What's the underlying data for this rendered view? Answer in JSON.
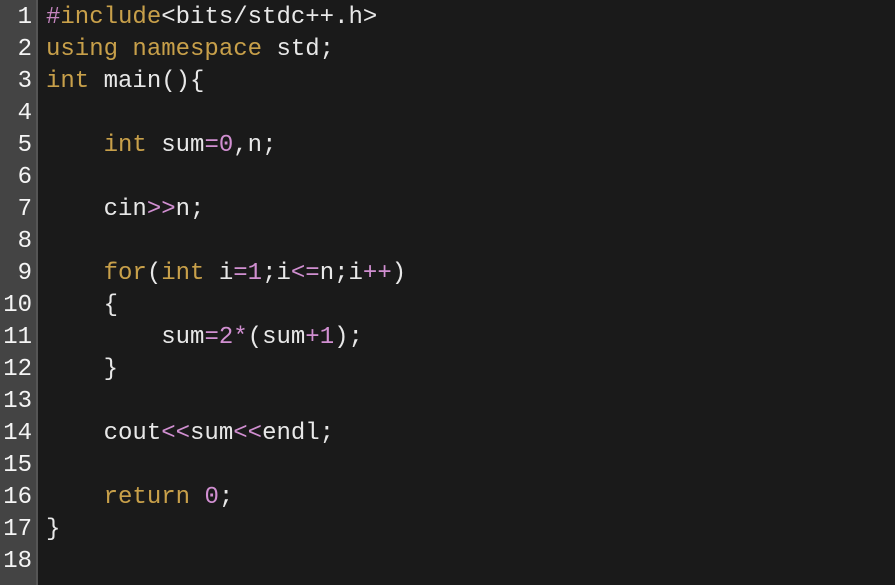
{
  "editor": {
    "line_count": 18,
    "line_numbers": [
      "1",
      "2",
      "3",
      "4",
      "5",
      "6",
      "7",
      "8",
      "9",
      "10",
      "11",
      "12",
      "13",
      "14",
      "15",
      "16",
      "17",
      "18"
    ],
    "lines": [
      {
        "tokens": [
          {
            "cls": "tk-include-pf",
            "t": "#"
          },
          {
            "cls": "tk-include-kw",
            "t": "include"
          },
          {
            "cls": "tk-angle",
            "t": "<bits/stdc++.h>"
          }
        ]
      },
      {
        "tokens": [
          {
            "cls": "tk-keyword",
            "t": "using"
          },
          {
            "cls": "tk-ident",
            "t": " "
          },
          {
            "cls": "tk-keyword",
            "t": "namespace"
          },
          {
            "cls": "tk-ident",
            "t": " std"
          },
          {
            "cls": "tk-semi",
            "t": ";"
          }
        ]
      },
      {
        "tokens": [
          {
            "cls": "tk-type",
            "t": "int"
          },
          {
            "cls": "tk-ident",
            "t": " "
          },
          {
            "cls": "tk-func",
            "t": "main"
          },
          {
            "cls": "tk-paren",
            "t": "()"
          },
          {
            "cls": "tk-brace",
            "t": "{"
          }
        ]
      },
      {
        "tokens": []
      },
      {
        "tokens": [
          {
            "cls": "tk-ident",
            "t": "    "
          },
          {
            "cls": "tk-type",
            "t": "int"
          },
          {
            "cls": "tk-ident",
            "t": " sum"
          },
          {
            "cls": "tk-eq",
            "t": "="
          },
          {
            "cls": "tk-number",
            "t": "0"
          },
          {
            "cls": "tk-punc",
            "t": ","
          },
          {
            "cls": "tk-ident",
            "t": "n"
          },
          {
            "cls": "tk-semi",
            "t": ";"
          }
        ]
      },
      {
        "tokens": []
      },
      {
        "tokens": [
          {
            "cls": "tk-ident",
            "t": "    cin"
          },
          {
            "cls": "tk-shift",
            "t": ">>"
          },
          {
            "cls": "tk-ident",
            "t": "n"
          },
          {
            "cls": "tk-semi",
            "t": ";"
          }
        ]
      },
      {
        "tokens": []
      },
      {
        "tokens": [
          {
            "cls": "tk-ident",
            "t": "    "
          },
          {
            "cls": "tk-keyword",
            "t": "for"
          },
          {
            "cls": "tk-paren",
            "t": "("
          },
          {
            "cls": "tk-type",
            "t": "int"
          },
          {
            "cls": "tk-ident",
            "t": " i"
          },
          {
            "cls": "tk-eq",
            "t": "="
          },
          {
            "cls": "tk-number",
            "t": "1"
          },
          {
            "cls": "tk-semi",
            "t": ";"
          },
          {
            "cls": "tk-ident",
            "t": "i"
          },
          {
            "cls": "tk-ltop",
            "t": "<="
          },
          {
            "cls": "tk-ident",
            "t": "n"
          },
          {
            "cls": "tk-semi",
            "t": ";"
          },
          {
            "cls": "tk-ident",
            "t": "i"
          },
          {
            "cls": "tk-plus",
            "t": "++"
          },
          {
            "cls": "tk-paren",
            "t": ")"
          }
        ]
      },
      {
        "tokens": [
          {
            "cls": "tk-ident",
            "t": "    "
          },
          {
            "cls": "tk-brace",
            "t": "{"
          }
        ]
      },
      {
        "tokens": [
          {
            "cls": "tk-ident",
            "t": "        sum"
          },
          {
            "cls": "tk-eq",
            "t": "="
          },
          {
            "cls": "tk-number",
            "t": "2"
          },
          {
            "cls": "tk-star",
            "t": "*"
          },
          {
            "cls": "tk-paren",
            "t": "("
          },
          {
            "cls": "tk-ident",
            "t": "sum"
          },
          {
            "cls": "tk-plus",
            "t": "+"
          },
          {
            "cls": "tk-number",
            "t": "1"
          },
          {
            "cls": "tk-paren",
            "t": ")"
          },
          {
            "cls": "tk-semi",
            "t": ";"
          }
        ]
      },
      {
        "tokens": [
          {
            "cls": "tk-ident",
            "t": "    "
          },
          {
            "cls": "tk-brace",
            "t": "}"
          }
        ]
      },
      {
        "tokens": []
      },
      {
        "tokens": [
          {
            "cls": "tk-ident",
            "t": "    cout"
          },
          {
            "cls": "tk-shift",
            "t": "<<"
          },
          {
            "cls": "tk-ident",
            "t": "sum"
          },
          {
            "cls": "tk-shift",
            "t": "<<"
          },
          {
            "cls": "tk-ident",
            "t": "endl"
          },
          {
            "cls": "tk-semi",
            "t": ";"
          }
        ]
      },
      {
        "tokens": []
      },
      {
        "tokens": [
          {
            "cls": "tk-ident",
            "t": "    "
          },
          {
            "cls": "tk-keyword",
            "t": "return"
          },
          {
            "cls": "tk-ident",
            "t": " "
          },
          {
            "cls": "tk-number",
            "t": "0"
          },
          {
            "cls": "tk-semi",
            "t": ";"
          }
        ]
      },
      {
        "tokens": [
          {
            "cls": "tk-brace",
            "t": "}"
          }
        ]
      },
      {
        "tokens": []
      }
    ]
  }
}
